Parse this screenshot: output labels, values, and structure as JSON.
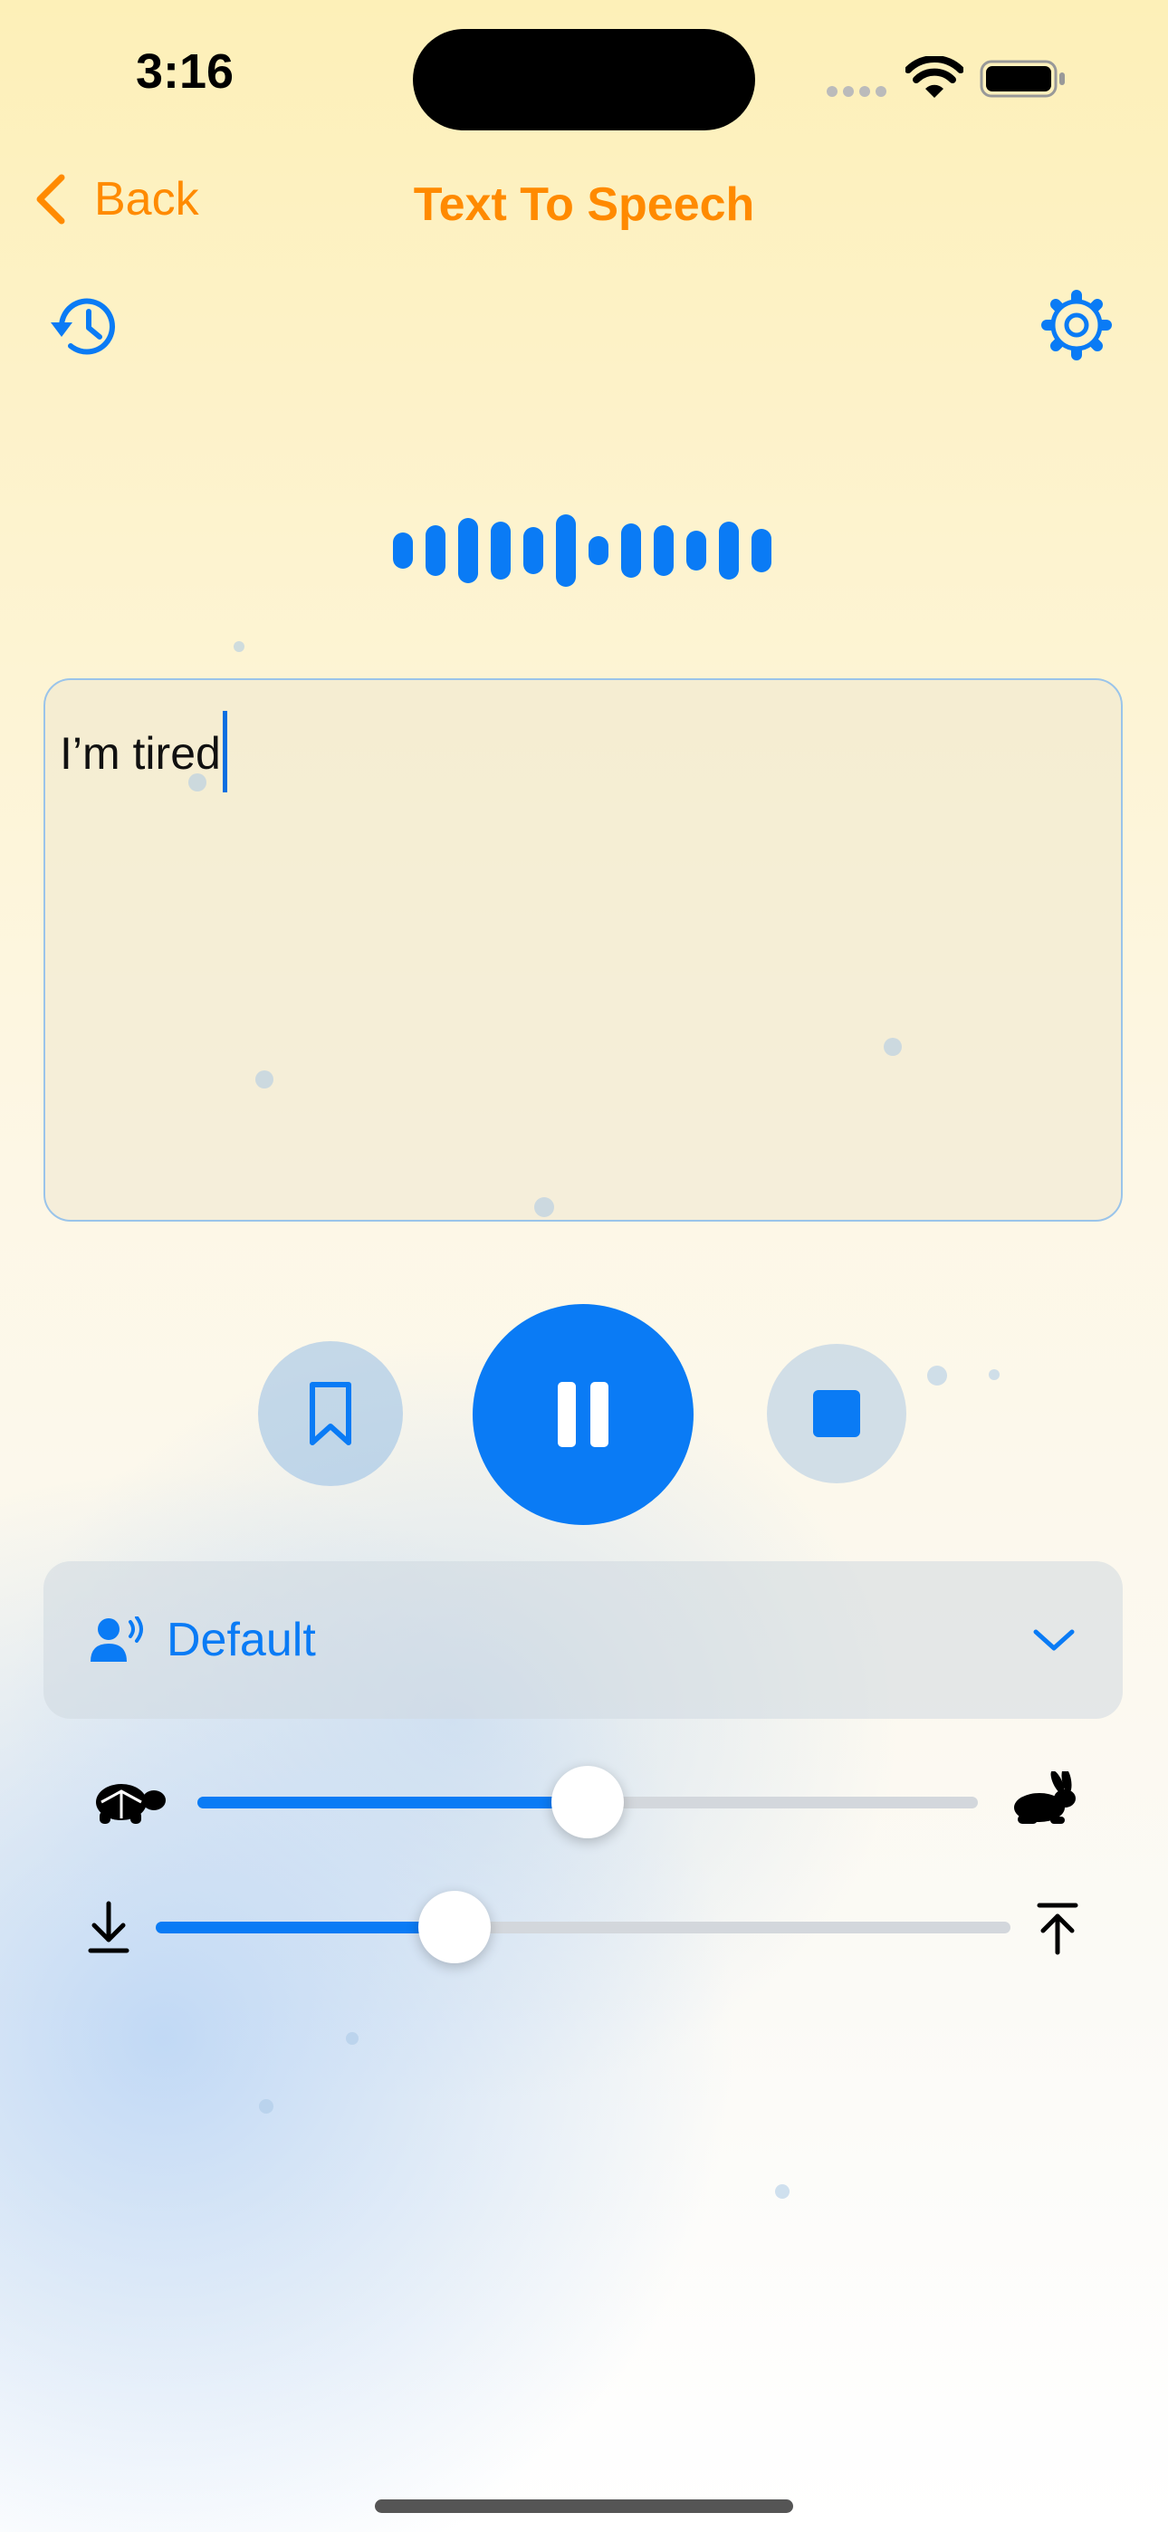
{
  "status_bar": {
    "time": "3:16"
  },
  "nav": {
    "back_label": "Back",
    "title": "Text To Speech"
  },
  "editor": {
    "text": "I’m tired"
  },
  "voice": {
    "selected": "Default"
  },
  "sliders": {
    "speed": 0.5,
    "pitch": 0.35
  },
  "colors": {
    "accent": "#0a7bf5",
    "nav": "#ff8a00"
  },
  "icons": [
    "history-icon",
    "gear-icon",
    "waveform-icon",
    "bookmark-icon",
    "pause-icon",
    "stop-icon",
    "voice-icon",
    "chevron-down-icon",
    "tortoise-icon",
    "hare-icon",
    "arrow-down-to-line-icon",
    "arrow-up-to-line-icon"
  ]
}
